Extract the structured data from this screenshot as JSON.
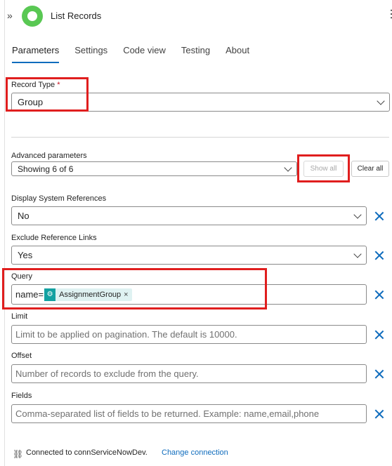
{
  "header": {
    "title": "List Records",
    "collapse_icon": "double-chevron-right-icon",
    "more_icon": "more-vertical-icon",
    "app_icon_color": "#59c853"
  },
  "tabs": [
    {
      "label": "Parameters",
      "active": true
    },
    {
      "label": "Settings"
    },
    {
      "label": "Code view"
    },
    {
      "label": "Testing"
    },
    {
      "label": "About"
    }
  ],
  "record_type": {
    "label": "Record Type",
    "required_mark": "*",
    "value": "Group"
  },
  "advanced": {
    "label": "Advanced parameters",
    "value": "Showing 6 of 6",
    "show_all": "Show all",
    "clear_all": "Clear all"
  },
  "display_refs": {
    "label": "Display System References",
    "value": "No"
  },
  "exclude_links": {
    "label": "Exclude Reference Links",
    "value": "Yes"
  },
  "query": {
    "label": "Query",
    "prefix": "name=",
    "token": "AssignmentGroup",
    "token_remove": "×"
  },
  "limit": {
    "label": "Limit",
    "placeholder": "Limit to be applied on pagination. The default is 10000."
  },
  "offset": {
    "label": "Offset",
    "placeholder": "Number of records to exclude from the query."
  },
  "fields": {
    "label": "Fields",
    "placeholder": "Comma-separated list of fields to be returned. Example: name,email,phone"
  },
  "footer": {
    "connected": "Connected to connServiceNowDev.",
    "change": "Change connection",
    "icon": "link-icon"
  },
  "colors": {
    "accent": "#0f6cbd",
    "highlight": "#e01e1e",
    "token_bg": "#dff2f2",
    "token_icon": "#13a1a1"
  }
}
